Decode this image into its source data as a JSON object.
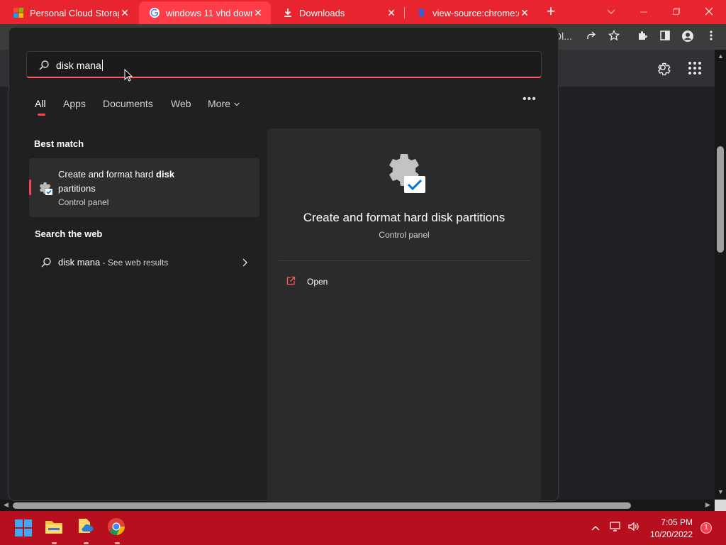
{
  "browser": {
    "tabs": [
      {
        "title": "Personal Cloud Storage",
        "favicon": "microsoft-logo-icon",
        "close": "✕"
      },
      {
        "title": "windows 11 vhd downl",
        "favicon": "google-logo-icon",
        "close": "✕"
      },
      {
        "title": "Downloads",
        "favicon": "download-icon",
        "close": "✕"
      },
      {
        "title": "view-source:chrome://",
        "favicon": "page-icon",
        "close": "✕"
      }
    ],
    "new_tab": "+",
    "omnibox_fragment": "Dl..."
  },
  "search": {
    "query": "disk mana",
    "filters": [
      "All",
      "Apps",
      "Documents",
      "Web",
      "More"
    ],
    "active_filter": "All",
    "more_dots": "•••",
    "best_match_heading": "Best match",
    "best_match": {
      "title_prefix": "Create and format hard ",
      "title_bold": "disk",
      "title_suffix": "partitions",
      "subtitle": "Control panel",
      "icon": "settings-gear-check-icon"
    },
    "web_heading": "Search the web",
    "web_result": {
      "query": "disk mana",
      "suffix": " - See web results"
    },
    "detail": {
      "title": "Create and format hard disk partitions",
      "subtitle": "Control panel",
      "action_open": "Open"
    }
  },
  "taskbar": {
    "apps": [
      "start-icon",
      "file-explorer-icon",
      "documents-icon",
      "chrome-icon"
    ],
    "time": "7:05 PM",
    "date": "10/20/2022",
    "notification_count": "1"
  },
  "colors": {
    "accent": "#ff4451",
    "tabstrip": "#e8242f",
    "taskbar": "#b70f1e",
    "flyout": "#202020"
  }
}
